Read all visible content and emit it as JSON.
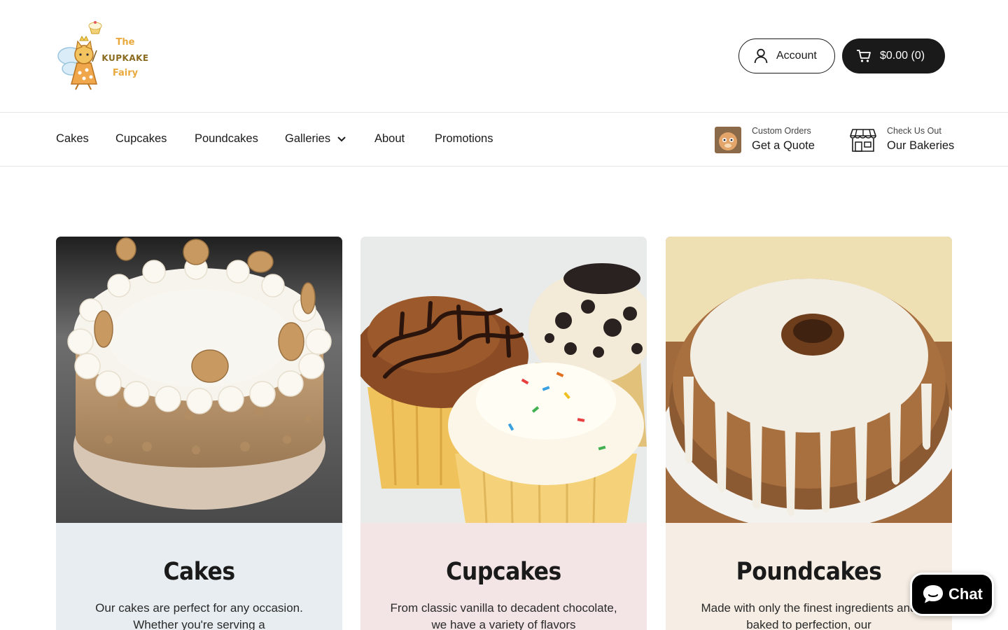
{
  "header": {
    "logo": {
      "line1": "The",
      "line2": "KUPKAKE",
      "line3": "Fairy"
    },
    "account_label": "Account",
    "cart_label": "$0.00 (0)"
  },
  "nav": {
    "items": [
      {
        "label": "Cakes"
      },
      {
        "label": "Cupcakes"
      },
      {
        "label": "Poundcakes"
      },
      {
        "label": "Galleries"
      },
      {
        "label": "About"
      },
      {
        "label": "Promotions"
      }
    ],
    "promos": [
      {
        "small": "Custom Orders",
        "big": "Get a Quote"
      },
      {
        "small": "Check Us Out",
        "big": "Our Bakeries"
      }
    ]
  },
  "cards": [
    {
      "title": "Cakes",
      "text": "Our cakes are perfect for any occasion. Whether you're serving a",
      "bg": "#e7edf0"
    },
    {
      "title": "Cupcakes",
      "text": "From classic vanilla to decadent chocolate, we have a variety of flavors",
      "bg": "#f3e5e5"
    },
    {
      "title": "Poundcakes",
      "text": "Made with only the finest ingredients and baked to perfection, our",
      "bg": "#f6eee4"
    }
  ],
  "chat": {
    "label": "Chat"
  },
  "colors": {
    "dark": "#1a1a1a",
    "border": "#e6e6e6"
  }
}
